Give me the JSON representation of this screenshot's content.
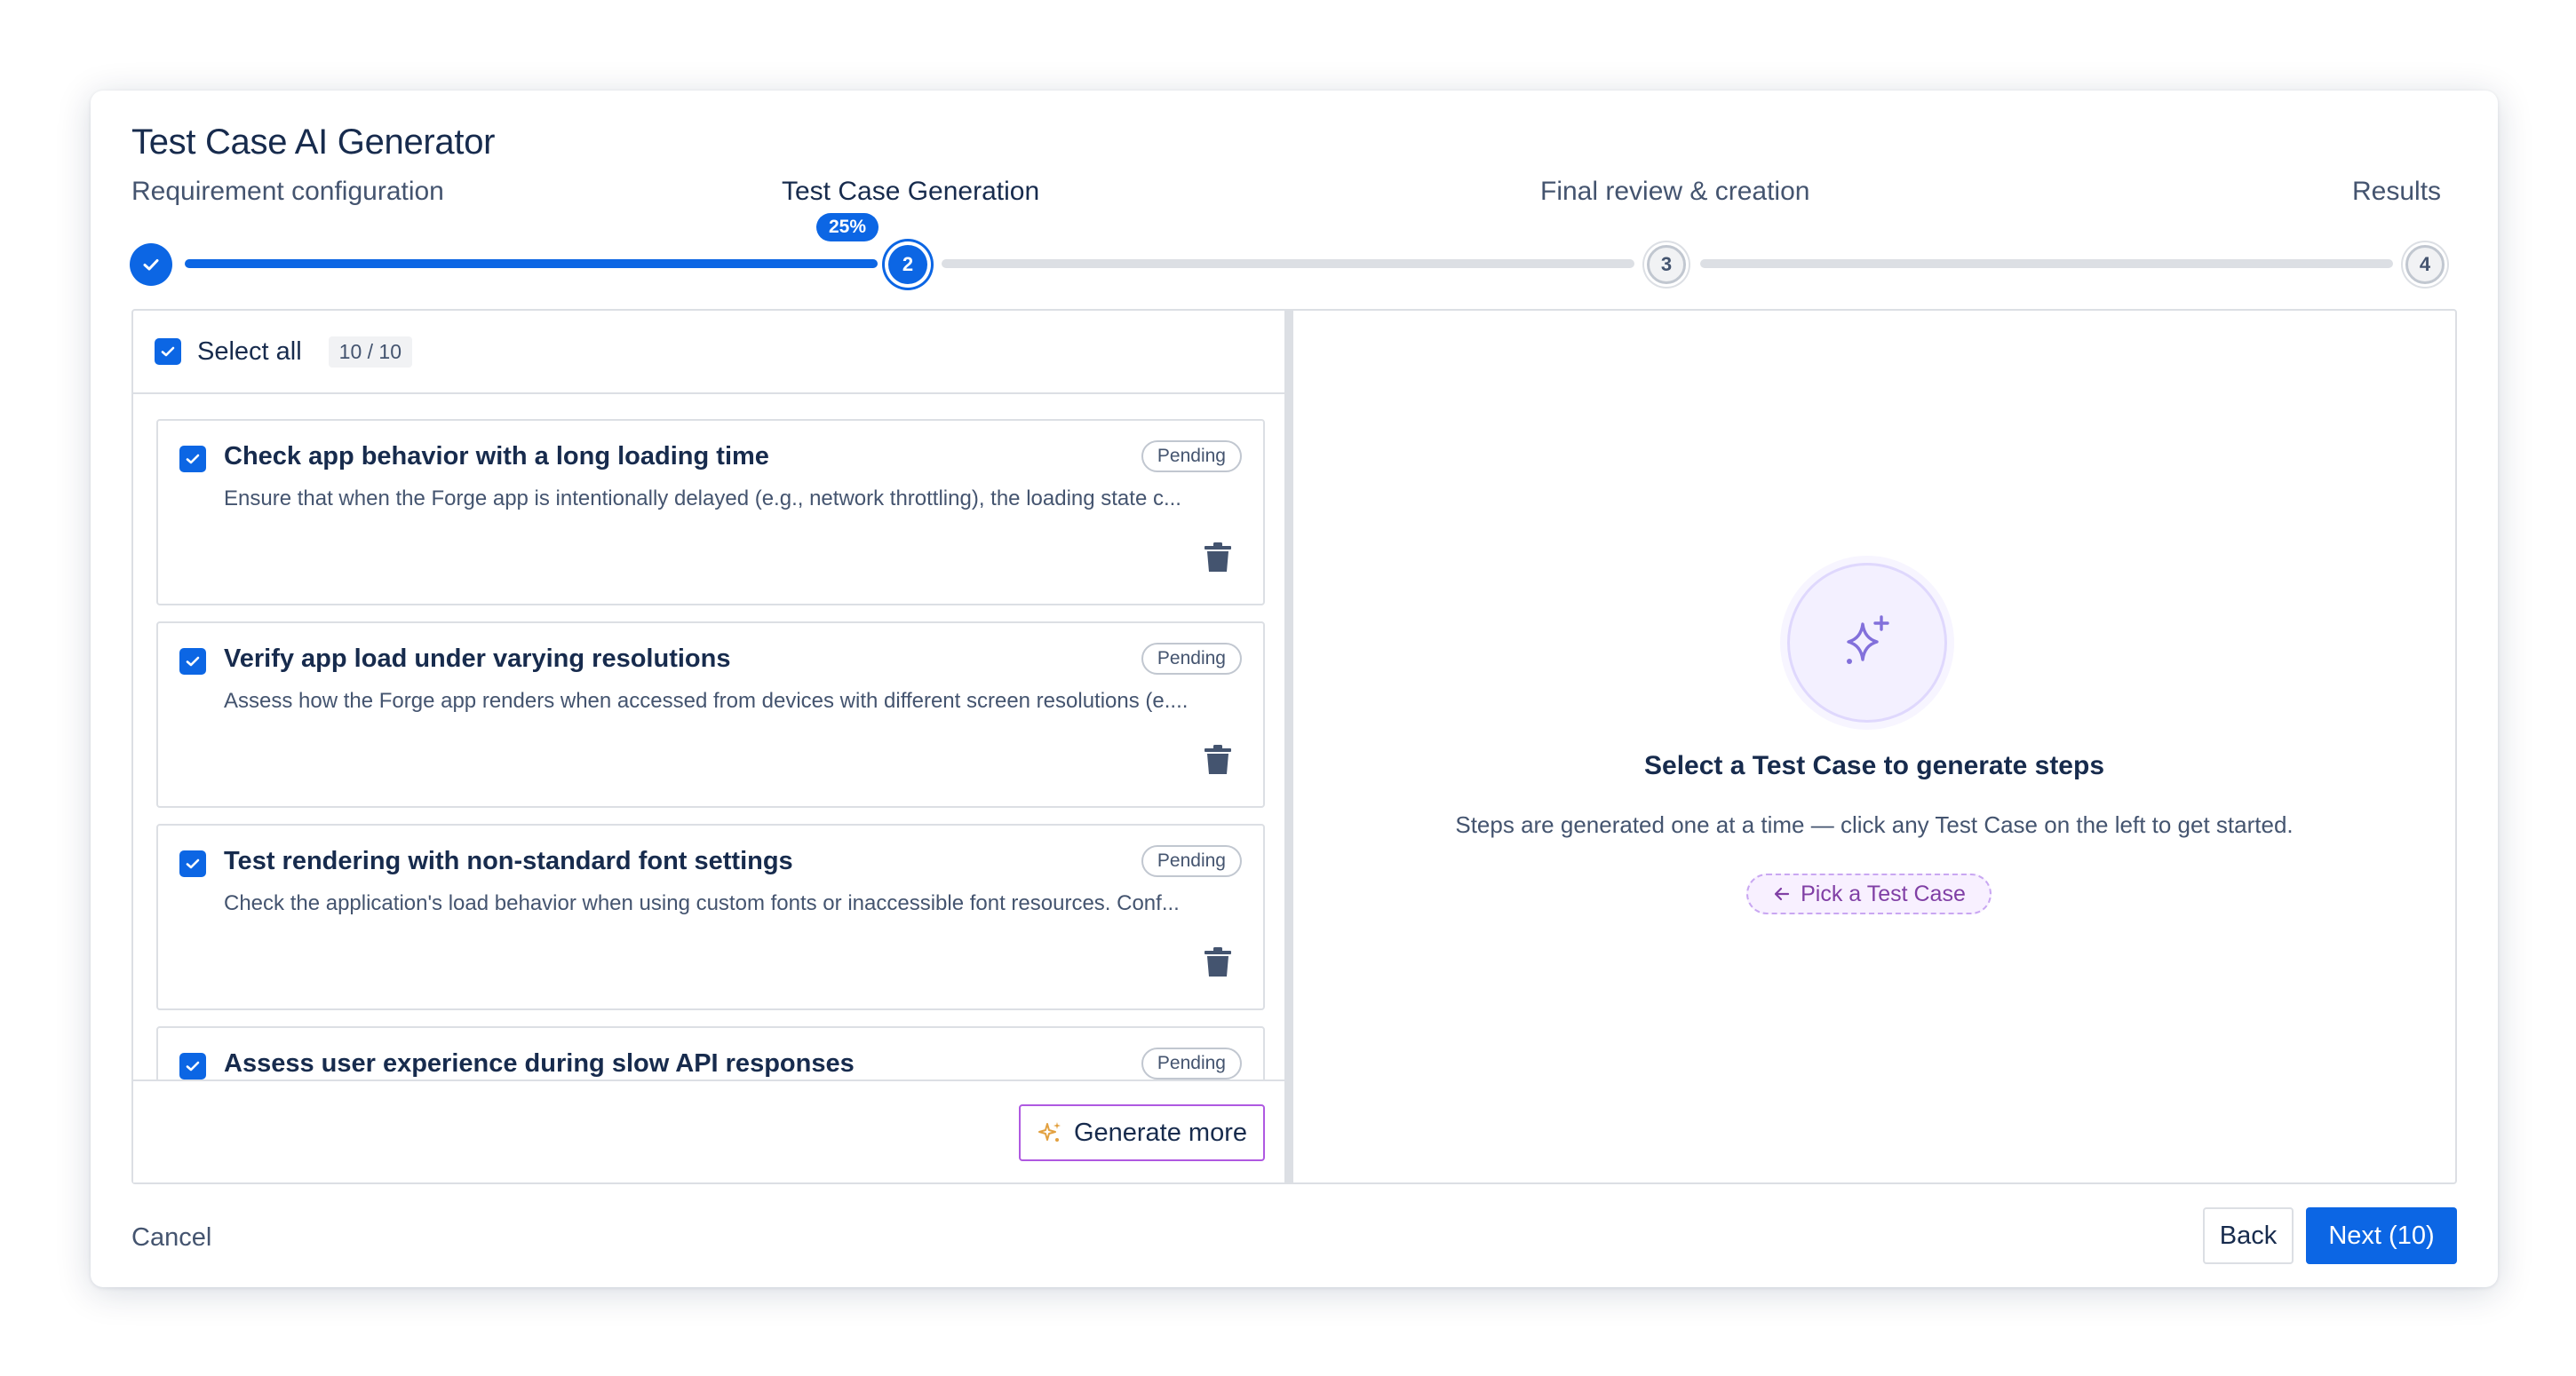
{
  "dialog": {
    "title": "Test Case AI Generator"
  },
  "stepper": {
    "steps": [
      {
        "label": "Requirement configuration",
        "number": "",
        "state": "done"
      },
      {
        "label": "Test Case Generation",
        "number": "2",
        "state": "current"
      },
      {
        "label": "Final review & creation",
        "number": "3",
        "state": "todo"
      },
      {
        "label": "Results",
        "number": "4",
        "state": "todo"
      }
    ],
    "progress_badge": "25%",
    "progress_fraction": 0.25
  },
  "list_panel": {
    "select_all_label": "Select all",
    "count": "10 / 10",
    "cards": [
      {
        "title": "Check app behavior with a long loading time",
        "status": "Pending",
        "description": "Ensure that when the Forge app is intentionally delayed (e.g., network throttling), the loading state c..."
      },
      {
        "title": "Verify app load under varying resolutions",
        "status": "Pending",
        "description": "Assess how the Forge app renders when accessed from devices with different screen resolutions (e...."
      },
      {
        "title": "Test rendering with non-standard font settings",
        "status": "Pending",
        "description": "Check the application's load behavior when using custom fonts or inaccessible font resources. Conf..."
      },
      {
        "title": "Assess user experience during slow API responses",
        "status": "Pending",
        "description": ""
      }
    ],
    "generate_more_label": "Generate more"
  },
  "detail_panel": {
    "icon": "sparkle-icon",
    "title": "Select a Test Case to generate steps",
    "text": "Steps are generated one at a time — click any Test Case on the left to get started.",
    "pick_label": "Pick a Test Case"
  },
  "footer": {
    "cancel_label": "Cancel",
    "back_label": "Back",
    "next_label": "Next (10)"
  },
  "colors": {
    "primary": "#0c66e4",
    "border": "#dcdfe4",
    "text": "#172b4d",
    "subtle_text": "#44546f",
    "accent_purple": "#af59e1"
  }
}
